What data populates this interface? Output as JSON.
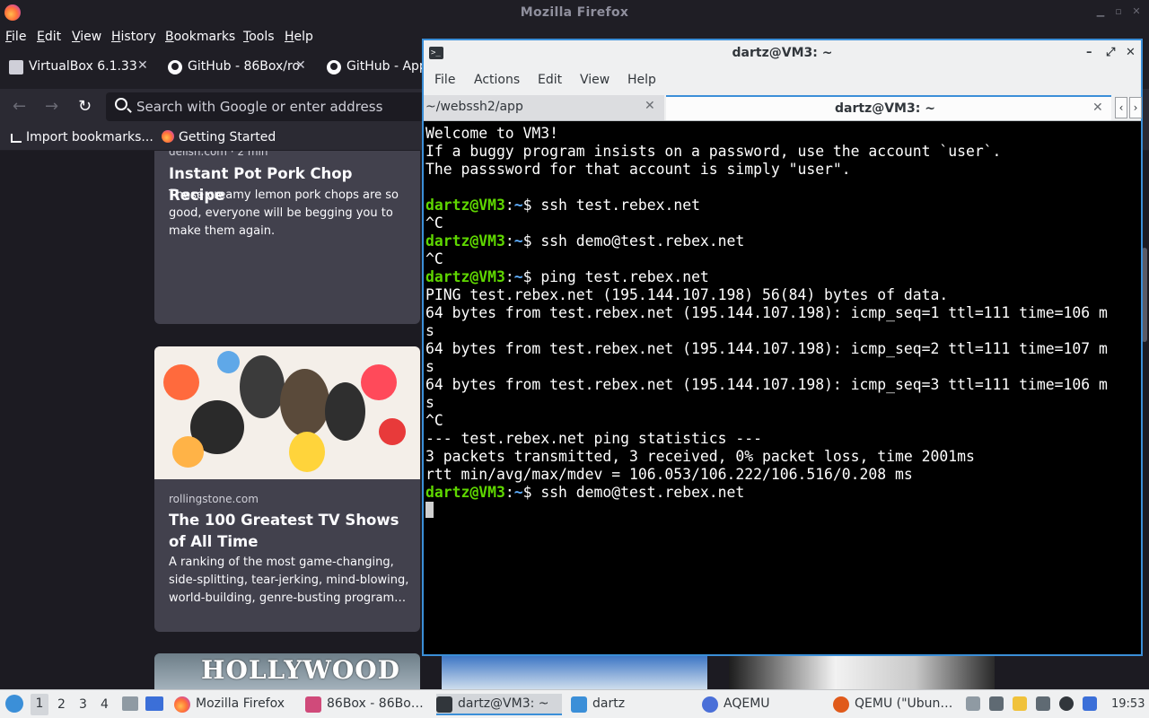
{
  "firefox": {
    "window_title": "Mozilla Firefox",
    "menu": [
      "File",
      "Edit",
      "View",
      "History",
      "Bookmarks",
      "Tools",
      "Help"
    ],
    "tabs": [
      {
        "label": "VirtualBox 6.1.33",
        "icon": "virtualbox-icon"
      },
      {
        "label": "GitHub - 86Box/ro",
        "icon": "github-icon"
      },
      {
        "label": "GitHub - App",
        "icon": "github-icon"
      }
    ],
    "url_placeholder": "Search with Google or enter address",
    "bookmarks": [
      {
        "label": "Import bookmarks...",
        "icon": "import-icon"
      },
      {
        "label": "Getting Started",
        "icon": "firefox-icon"
      }
    ],
    "cards": [
      {
        "source": "delish.com · 2 min",
        "title": "Instant Pot Pork Chop Recipe",
        "description": "These creamy lemon pork chops are so good, everyone will be begging you to make them again."
      },
      {
        "source": "rollingstone.com",
        "title": "The 100 Greatest TV Shows of All Time",
        "description": "A ranking of the most game-changing, side-splitting, tear-jerking, mind-blowing, world-building, genre-busting program…"
      },
      {
        "image_text": "HOLLYWOOD"
      }
    ]
  },
  "terminal": {
    "window_title": "dartz@VM3: ~",
    "menu": [
      "File",
      "Actions",
      "Edit",
      "View",
      "Help"
    ],
    "tabs": [
      {
        "label": "~/webssh2/app",
        "active": false
      },
      {
        "label": "dartz@VM3: ~",
        "active": true
      }
    ],
    "prompt_user": "dartz@VM3",
    "prompt_sep": ":",
    "prompt_path": "~",
    "prompt_dollar": "$ ",
    "lines": [
      {
        "type": "out",
        "text": "Welcome to VM3!"
      },
      {
        "type": "out",
        "text": "If a buggy program insists on a password, use the account `user`."
      },
      {
        "type": "out",
        "text": "The passsword for that account is simply \"user\"."
      },
      {
        "type": "out",
        "text": ""
      },
      {
        "type": "cmd",
        "text": "ssh test.rebex.net"
      },
      {
        "type": "out",
        "text": "^C"
      },
      {
        "type": "cmd",
        "text": "ssh demo@test.rebex.net"
      },
      {
        "type": "out",
        "text": "^C"
      },
      {
        "type": "cmd",
        "text": "ping test.rebex.net"
      },
      {
        "type": "out",
        "text": "PING test.rebex.net (195.144.107.198) 56(84) bytes of data."
      },
      {
        "type": "out",
        "text": "64 bytes from test.rebex.net (195.144.107.198): icmp_seq=1 ttl=111 time=106 m"
      },
      {
        "type": "out",
        "text": "s"
      },
      {
        "type": "out",
        "text": "64 bytes from test.rebex.net (195.144.107.198): icmp_seq=2 ttl=111 time=107 m"
      },
      {
        "type": "out",
        "text": "s"
      },
      {
        "type": "out",
        "text": "64 bytes from test.rebex.net (195.144.107.198): icmp_seq=3 ttl=111 time=106 m"
      },
      {
        "type": "out",
        "text": "s"
      },
      {
        "type": "out",
        "text": "^C"
      },
      {
        "type": "out",
        "text": "--- test.rebex.net ping statistics ---"
      },
      {
        "type": "out",
        "text": "3 packets transmitted, 3 received, 0% packet loss, time 2001ms"
      },
      {
        "type": "out",
        "text": "rtt min/avg/max/mdev = 106.053/106.222/106.516/0.208 ms"
      },
      {
        "type": "cmd",
        "text": "ssh demo@test.rebex.net"
      }
    ]
  },
  "taskbar": {
    "workspaces": [
      "1",
      "2",
      "3",
      "4"
    ],
    "tasks": [
      {
        "label": "Mozilla Firefox",
        "icon": "firefox-icon",
        "color": "#ff7139"
      },
      {
        "label": "86Box - 86Bo…",
        "icon": "86box-icon",
        "color": "#d04a7a"
      },
      {
        "label": "dartz@VM3: ~",
        "icon": "terminal-icon",
        "color": "#31363b"
      },
      {
        "label": "dartz",
        "icon": "folder-icon",
        "color": "#3b8fd8"
      },
      {
        "label": "AQEMU",
        "icon": "aqemu-icon",
        "color": "#4a6fd8"
      },
      {
        "label": "QEMU (\"Ubun…",
        "icon": "qemu-icon",
        "color": "#e05a1a"
      }
    ],
    "clock": "19:53"
  }
}
